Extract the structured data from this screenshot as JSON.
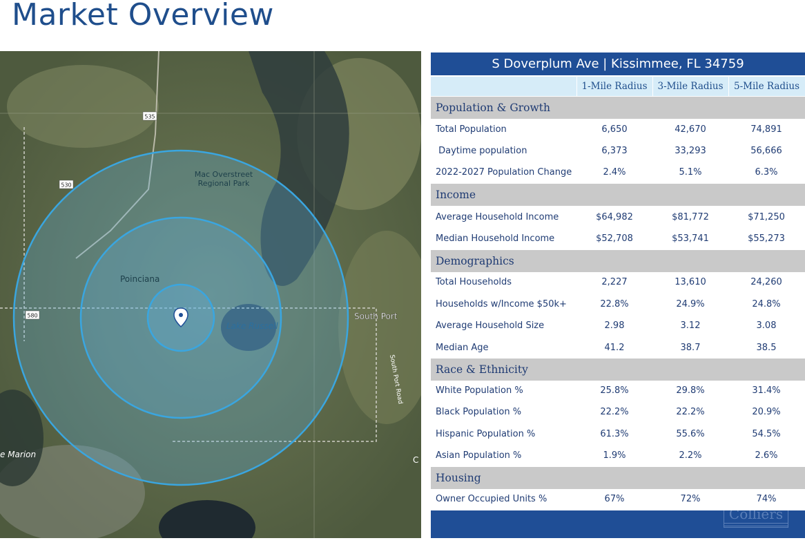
{
  "page": {
    "title": "Market Overview"
  },
  "map": {
    "labels": {
      "road_535": "535",
      "road_530": "530",
      "road_580": "580",
      "park": "Mac Overstreet",
      "park_line2": "Regional Park",
      "poinciana": "Poinciana",
      "lake_russell": "Lake Russell",
      "south_port": "South Port",
      "road_side": "South Port Road",
      "lake_marion": "e Marion",
      "edge_c": "C"
    },
    "pin": "map-pin"
  },
  "table": {
    "address": "S Doverplum Ave | Kissimmee, FL 34759",
    "columns": [
      "1-Mile Radius",
      "3-Mile Radius",
      "5-Mile Radius"
    ],
    "sections": [
      {
        "name": "Population & Growth",
        "rows": [
          {
            "label": "Total Population",
            "values": [
              "6,650",
              "42,670",
              "74,891"
            ]
          },
          {
            "label": " Daytime population",
            "values": [
              "6,373",
              "33,293",
              "56,666"
            ]
          },
          {
            "label": "2022-2027 Population Change",
            "values": [
              "2.4%",
              "5.1%",
              "6.3%"
            ]
          }
        ]
      },
      {
        "name": "Income",
        "rows": [
          {
            "label": "Average Household Income",
            "values": [
              "$64,982",
              "$81,772",
              "$71,250"
            ]
          },
          {
            "label": "Median Household Income",
            "values": [
              "$52,708",
              "$53,741",
              "$55,273"
            ]
          }
        ]
      },
      {
        "name": "Demographics",
        "rows": [
          {
            "label": "Total Households",
            "values": [
              "2,227",
              "13,610",
              "24,260"
            ]
          },
          {
            "label": "Households w/Income $50k+",
            "values": [
              "22.8%",
              "24.9%",
              "24.8%"
            ]
          },
          {
            "label": "Average Household Size",
            "values": [
              "2.98",
              "3.12",
              "3.08"
            ]
          },
          {
            "label": "Median Age",
            "values": [
              "41.2",
              "38.7",
              "38.5"
            ]
          }
        ]
      },
      {
        "name": "Race & Ethnicity",
        "rows": [
          {
            "label": "White Population %",
            "values": [
              "25.8%",
              "29.8%",
              "31.4%"
            ]
          },
          {
            "label": "Black Population %",
            "values": [
              "22.2%",
              "22.2%",
              "20.9%"
            ]
          },
          {
            "label": "Hispanic Population %",
            "values": [
              "61.3%",
              "55.6%",
              "54.5%"
            ]
          },
          {
            "label": "Asian Population %",
            "values": [
              "1.9%",
              "2.2%",
              "2.6%"
            ]
          }
        ]
      },
      {
        "name": "Housing",
        "rows": [
          {
            "label": "Owner Occupied Units %",
            "values": [
              "67%",
              "72%",
              "74%"
            ]
          }
        ]
      }
    ],
    "footer_logo": "Colliers"
  },
  "colors": {
    "brand_blue": "#1f4e96",
    "header_light": "#d6ecf8",
    "section_gray": "#c9c9c9",
    "text_navy": "#1f3b73"
  }
}
